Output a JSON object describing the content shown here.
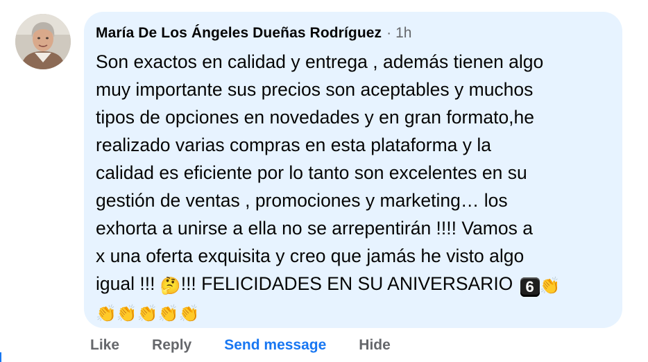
{
  "comment": {
    "author": "María De Los Ángeles Dueñas Rodríguez",
    "separator": "·",
    "time": "1h",
    "lines": [
      "Son exactos en calidad y entrega , además tienen algo",
      "muy importante sus precios son aceptables y muchos",
      "tipos de opciones en novedades y en gran formato,he",
      "realizado varias compras en esta plataforma y la",
      "calidad es eficiente por lo tanto son excelentes en su",
      "gestión de ventas , promociones y marketing… los",
      "exhorta a unirse a ella no se arrepentirán !!!! Vamos a",
      "x una oferta exquisita y creo que jamás he visto algo"
    ],
    "line9_part1": "igual !!! ",
    "emoji_thinking": "🤔",
    "line9_part2": "!!! FELICIDADES EN SU ANIVERSARIO ",
    "number_badge": "6",
    "emoji_clap": "👏",
    "clap_row": "👏👏👏👏👏"
  },
  "actions": {
    "like": "Like",
    "reply": "Reply",
    "send_message": "Send message",
    "hide": "Hide"
  },
  "colors": {
    "bubble": "#e7f3ff",
    "link": "#1877f2",
    "muted": "#65676b",
    "text": "#050505"
  },
  "icons": {
    "avatar": "profile-photo"
  }
}
